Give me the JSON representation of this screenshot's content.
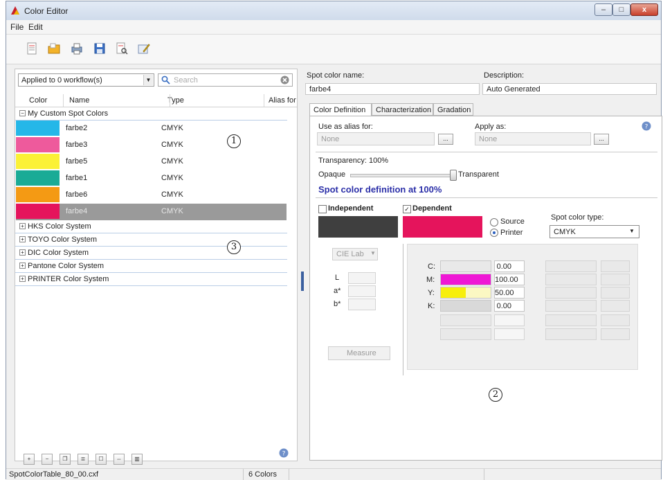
{
  "window": {
    "title": "Color Editor",
    "buttons": [
      "–",
      "□",
      "x"
    ]
  },
  "menu": {
    "items": [
      "File",
      "Edit"
    ]
  },
  "toolbar": {
    "icons": [
      "new-document-icon",
      "open-folder-icon",
      "print-icon",
      "save-icon",
      "preview-icon",
      "edit-icon"
    ]
  },
  "left": {
    "workflow_combo": "Applied to 0 workflow(s)",
    "search_placeholder": "Search",
    "columns": [
      "Color",
      "Name",
      "Type",
      "Alias for"
    ],
    "custom_group": "My Custom Spot Colors",
    "colors": [
      {
        "name": "farbe2",
        "type": "CMYK",
        "swatch": "#25b7e8"
      },
      {
        "name": "farbe3",
        "type": "CMYK",
        "swatch": "#ee5a9c"
      },
      {
        "name": "farbe5",
        "type": "CMYK",
        "swatch": "#fbf136"
      },
      {
        "name": "farbe1",
        "type": "CMYK",
        "swatch": "#1aab96"
      },
      {
        "name": "farbe6",
        "type": "CMYK",
        "swatch": "#f49a14"
      },
      {
        "name": "farbe4",
        "type": "CMYK",
        "swatch": "#e5145c"
      }
    ],
    "groups": [
      "HKS Color System",
      "TOYO Color System",
      "DIC Color System",
      "Pantone Color System",
      "PRINTER Color System"
    ],
    "bottom_icons": [
      "add-color-icon",
      "remove-color-icon",
      "duplicate-icon",
      "list-view-icon",
      "properties-icon",
      "merge-icon",
      "export-icon"
    ]
  },
  "right": {
    "spot_name_label": "Spot color name:",
    "spot_name_value": "farbe4",
    "description_label": "Description:",
    "description_value": "Auto Generated",
    "tabs": [
      "Color Definition",
      "Characterization",
      "Gradation"
    ],
    "alias_label": "Use as alias for:",
    "alias_value": "None",
    "apply_label": "Apply as:",
    "apply_value": "None",
    "browse_label": "...",
    "transparency_label": "Transparency: 100%",
    "opaque_label": "Opaque",
    "transparent_label": "Transparent",
    "transparency_level": 1.0,
    "definition_heading": "Spot color definition at 100%",
    "independent_label": "Independent",
    "dependent_label": "Dependent",
    "dependent_checked": "✓",
    "source_label": "Source",
    "printer_label": "Printer",
    "spot_type_label": "Spot color type:",
    "spot_type_value": "CMYK",
    "cielab_value": "CIE Lab",
    "lab_labels": [
      "L",
      "a*",
      "b*"
    ],
    "measure_label": "Measure",
    "cmyk": [
      {
        "label": "C:",
        "value": "0.00",
        "fraction": 0.0,
        "color": "#d7f6fb"
      },
      {
        "label": "M:",
        "value": "100.00",
        "fraction": 1.0,
        "color": "#ef17d5"
      },
      {
        "label": "Y:",
        "value": "50.00",
        "fraction": 0.5,
        "color": "#f7ef0c"
      },
      {
        "label": "K:",
        "value": "0.00",
        "fraction": 0.0,
        "color": "#d9d9d9"
      }
    ],
    "independent_swatch": "#3f3f3f",
    "dependent_swatch": "#e5145c"
  },
  "status": {
    "file": "SpotColorTable_80_00.cxf",
    "count": "6 Colors"
  },
  "callouts": [
    "1",
    "2",
    "3"
  ],
  "colors": {
    "accent": "#2b2fa8",
    "selection": "#9a9a9a",
    "group_line": "#b9cde6"
  }
}
